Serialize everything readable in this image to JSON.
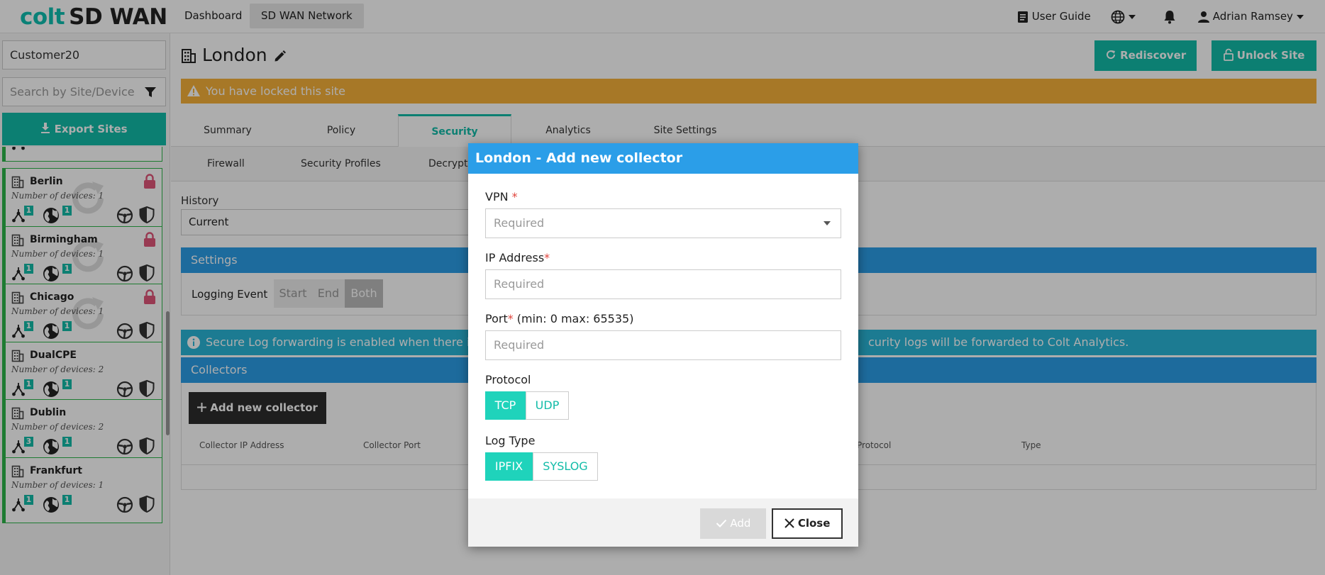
{
  "app": {
    "logo_colt": "colt",
    "logo_product": "SD WAN",
    "nav": [
      "Dashboard",
      "SD WAN Network"
    ],
    "user_guide": "User Guide",
    "user_name": "Adrian Ramsey",
    "accent_color": "#12bca8"
  },
  "sidebar": {
    "customer": "Customer20",
    "search_placeholder": "Search by Site/Device",
    "export_label": "Export Sites",
    "sites": [
      {
        "name": "Berlin",
        "devices": "Number of devices: 1",
        "badge_a": "1",
        "badge_b": "1",
        "locked": true
      },
      {
        "name": "Birmingham",
        "devices": "Number of devices: 1",
        "badge_a": "1",
        "badge_b": "1",
        "locked": true
      },
      {
        "name": "Chicago",
        "devices": "Number of devices: 1",
        "badge_a": "1",
        "badge_b": "1",
        "locked": true
      },
      {
        "name": "DualCPE",
        "devices": "Number of devices: 2",
        "badge_a": "1",
        "badge_b": "1",
        "locked": false
      },
      {
        "name": "Dublin",
        "devices": "Number of devices: 2",
        "badge_a": "3",
        "badge_b": "1",
        "locked": false
      },
      {
        "name": "Frankfurt",
        "devices": "Number of devices: 1",
        "badge_a": "1",
        "badge_b": "1",
        "locked": false
      }
    ]
  },
  "main": {
    "title": "London",
    "rediscover": "Rediscover",
    "unlock": "Unlock Site",
    "lock_notice": "You have locked this site",
    "tabs": [
      "Summary",
      "Policy",
      "Security",
      "Analytics",
      "Site Settings"
    ],
    "subtabs": [
      "Firewall",
      "Security Profiles",
      "Decrypt"
    ],
    "history_label": "History",
    "history_value": "Current",
    "settings_title": "Settings",
    "logging_event_label": "Logging Event",
    "logging_options": [
      "Start",
      "End",
      "Both"
    ],
    "info_left": "Secure Log forwarding is enabled when there i",
    "info_right": "curity logs will be forwarded to Colt Analytics.",
    "collectors_title": "Collectors",
    "add_collector": "Add new collector",
    "columns": [
      "Collector IP Address",
      "Collector Port",
      "Protocol",
      "Type"
    ]
  },
  "modal": {
    "title": "London - Add new collector",
    "vpn_label": "VPN",
    "vpn_placeholder": "Required",
    "ip_label": "IP Address",
    "ip_placeholder": "Required",
    "port_label": "Port",
    "port_hint": " (min: 0 max: 65535)",
    "port_placeholder": "Required",
    "protocol_label": "Protocol",
    "protocol_options": [
      "TCP",
      "UDP"
    ],
    "logtype_label": "Log Type",
    "logtype_options": [
      "IPFIX",
      "SYSLOG"
    ],
    "add_label": "Add",
    "close_label": "Close",
    "required_mark": "*"
  }
}
